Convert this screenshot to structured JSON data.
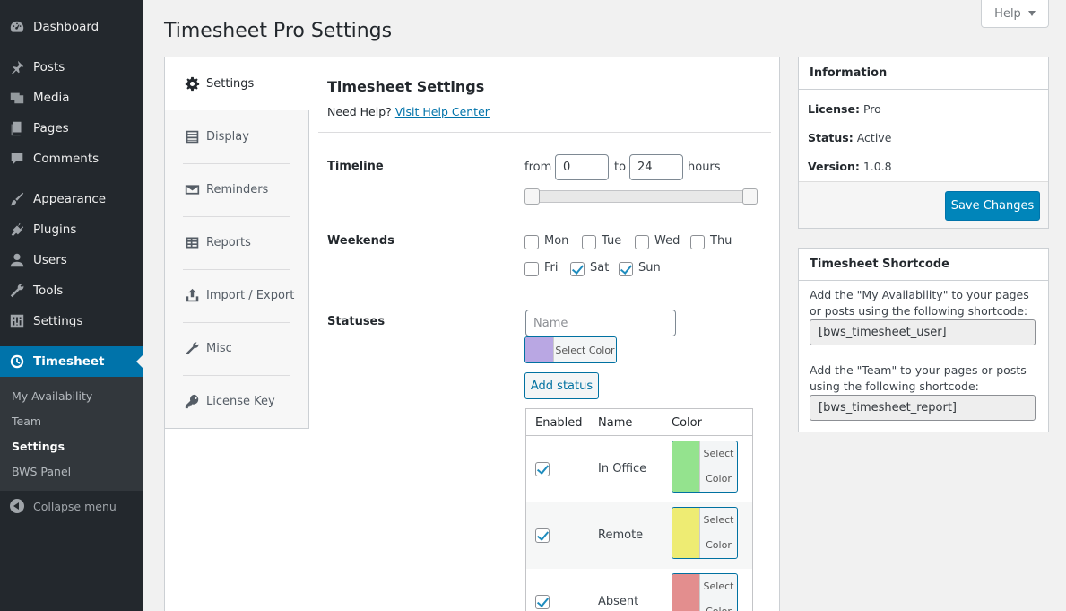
{
  "sidebar": {
    "items": [
      {
        "label": "Dashboard",
        "icon": "dashboard-icon"
      },
      {
        "label": "Posts",
        "icon": "pin-icon"
      },
      {
        "label": "Media",
        "icon": "media-icon"
      },
      {
        "label": "Pages",
        "icon": "pages-icon"
      },
      {
        "label": "Comments",
        "icon": "comment-icon"
      },
      {
        "label": "Appearance",
        "icon": "brush-icon"
      },
      {
        "label": "Plugins",
        "icon": "plug-icon"
      },
      {
        "label": "Users",
        "icon": "user-icon"
      },
      {
        "label": "Tools",
        "icon": "wrench-icon"
      },
      {
        "label": "Settings",
        "icon": "sliders-icon"
      },
      {
        "label": "Timesheet",
        "icon": "clock-icon"
      }
    ],
    "submenu": [
      "My Availability",
      "Team",
      "Settings",
      "BWS Panel"
    ],
    "collapse_label": "Collapse menu"
  },
  "header": {
    "title": "Timesheet Pro Settings",
    "help_label": "Help"
  },
  "tabs": [
    {
      "label": "Settings",
      "icon": "gear-icon"
    },
    {
      "label": "Display",
      "icon": "list-icon"
    },
    {
      "label": "Reminders",
      "icon": "envelope-icon"
    },
    {
      "label": "Reports",
      "icon": "table-icon"
    },
    {
      "label": "Import / Export",
      "icon": "upload-icon"
    },
    {
      "label": "Misc",
      "icon": "wrench-icon"
    },
    {
      "label": "License Key",
      "icon": "key-icon"
    }
  ],
  "content": {
    "title": "Timesheet Settings",
    "help_prefix": "Need Help?",
    "help_link": "Visit Help Center",
    "timeline": {
      "label": "Timeline",
      "from_label": "from",
      "from_value": "0",
      "to_label": "to",
      "to_value": "24",
      "unit": "hours"
    },
    "weekends": {
      "label": "Weekends",
      "days": [
        {
          "label": "Mon",
          "checked": false
        },
        {
          "label": "Tue",
          "checked": false
        },
        {
          "label": "Wed",
          "checked": false
        },
        {
          "label": "Thu",
          "checked": false
        },
        {
          "label": "Fri",
          "checked": false
        },
        {
          "label": "Sat",
          "checked": true
        },
        {
          "label": "Sun",
          "checked": true
        }
      ]
    },
    "statuses": {
      "label": "Statuses",
      "name_placeholder": "Name",
      "new_color": "#b9a7e3",
      "select_color_label": "Select Color",
      "add_label": "Add status",
      "table_headers": [
        "Enabled",
        "Name",
        "Color"
      ],
      "select_word": "Select",
      "color_word": "Color",
      "rows": [
        {
          "name": "In Office",
          "enabled": true,
          "color": "#94e38e"
        },
        {
          "name": "Remote",
          "enabled": true,
          "color": "#eeec73"
        },
        {
          "name": "Absent",
          "enabled": true,
          "color": "#e38e8e"
        }
      ]
    }
  },
  "info_box": {
    "title": "Information",
    "license_label": "License:",
    "license_value": "Pro",
    "status_label": "Status:",
    "status_value": "Active",
    "version_label": "Version:",
    "version_value": "1.0.8",
    "save_label": "Save Changes"
  },
  "shortcode_box": {
    "title": "Timesheet Shortcode",
    "text1": "Add the \"My Availability\" to your pages or posts using the following shortcode:",
    "code1": "[bws_timesheet_user]",
    "text2": "Add the \"Team\" to your pages or posts using the following shortcode:",
    "code2": "[bws_timesheet_report]"
  }
}
